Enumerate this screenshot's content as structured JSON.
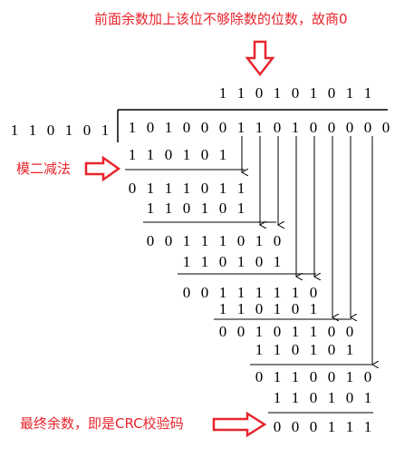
{
  "annotations": {
    "top": "前面余数加上该位不够除数的位数，故商0",
    "left": "模二减法",
    "bottom": "最终余数，即是CRC校验码"
  },
  "division": {
    "quotient": "110101011",
    "divisor": "110101",
    "dividend": "101000110100000",
    "steps": [
      {
        "subtrahend": "110101",
        "result": "0111011"
      },
      {
        "subtrahend": "110101",
        "result": "00111010"
      },
      {
        "subtrahend": "110101",
        "result": "00111110"
      },
      {
        "subtrahend": "110101",
        "result": "00101100"
      },
      {
        "subtrahend": "110101",
        "result": "0110010"
      },
      {
        "subtrahend": "110101",
        "result": "000111"
      }
    ]
  },
  "colors": {
    "annotation": "#e8242c",
    "text": "#000000"
  }
}
